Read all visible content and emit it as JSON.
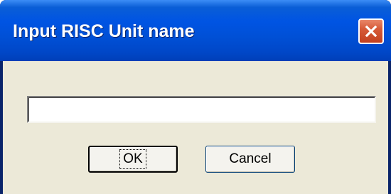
{
  "dialog": {
    "title": "Input RISC Unit name",
    "input": {
      "value": "",
      "placeholder": ""
    },
    "buttons": {
      "ok_label": "OK",
      "cancel_label": "Cancel"
    },
    "icons": {
      "close": "close-icon"
    },
    "colors": {
      "titlebar": "#0054e3",
      "client_background": "#ece9d8",
      "close_button": "#d65a38"
    }
  }
}
